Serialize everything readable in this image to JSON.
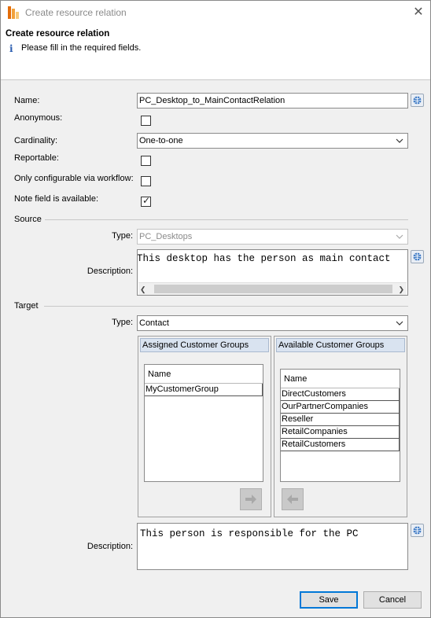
{
  "window": {
    "title": "Create resource relation"
  },
  "header": {
    "title": "Create resource relation",
    "message": "Please fill in the required fields."
  },
  "form": {
    "name_label": "Name:",
    "name_value": "PC_Desktop_to_MainContactRelation",
    "anonymous_label": "Anonymous:",
    "anonymous_checked": false,
    "cardinality_label": "Cardinality:",
    "cardinality_value": "One-to-one",
    "reportable_label": "Reportable:",
    "reportable_checked": false,
    "workflow_label": "Only configurable via workflow:",
    "workflow_checked": false,
    "note_label": "Note field is available:",
    "note_checked": true
  },
  "source": {
    "section_label": "Source",
    "type_label": "Type:",
    "type_value": "PC_Desktops",
    "description_label": "Description:",
    "description_value": "This desktop has the person as main contact"
  },
  "target": {
    "section_label": "Target",
    "type_label": "Type:",
    "type_value": "Contact",
    "assigned": {
      "title": "Assigned Customer Groups",
      "column": "Name",
      "rows": [
        "MyCustomerGroup"
      ]
    },
    "available": {
      "title": "Available Customer Groups",
      "column": "Name",
      "rows": [
        "DirectCustomers",
        "OurPartnerCompanies",
        "Reseller",
        "RetailCompanies",
        "RetailCustomers"
      ]
    },
    "description_label": "Description:",
    "description_value": "This person is responsible for the PC"
  },
  "buttons": {
    "save": "Save",
    "cancel": "Cancel"
  },
  "icons": {
    "app": "app-icon",
    "info": "info-icon",
    "globe": "globe-icon",
    "close": "close-icon",
    "arrow_right": "arrow-right-icon",
    "arrow_left": "arrow-left-icon"
  },
  "colors": {
    "accent": "#0078d7",
    "panel_header": "#d9e3f0",
    "background": "#f0f0f0"
  }
}
